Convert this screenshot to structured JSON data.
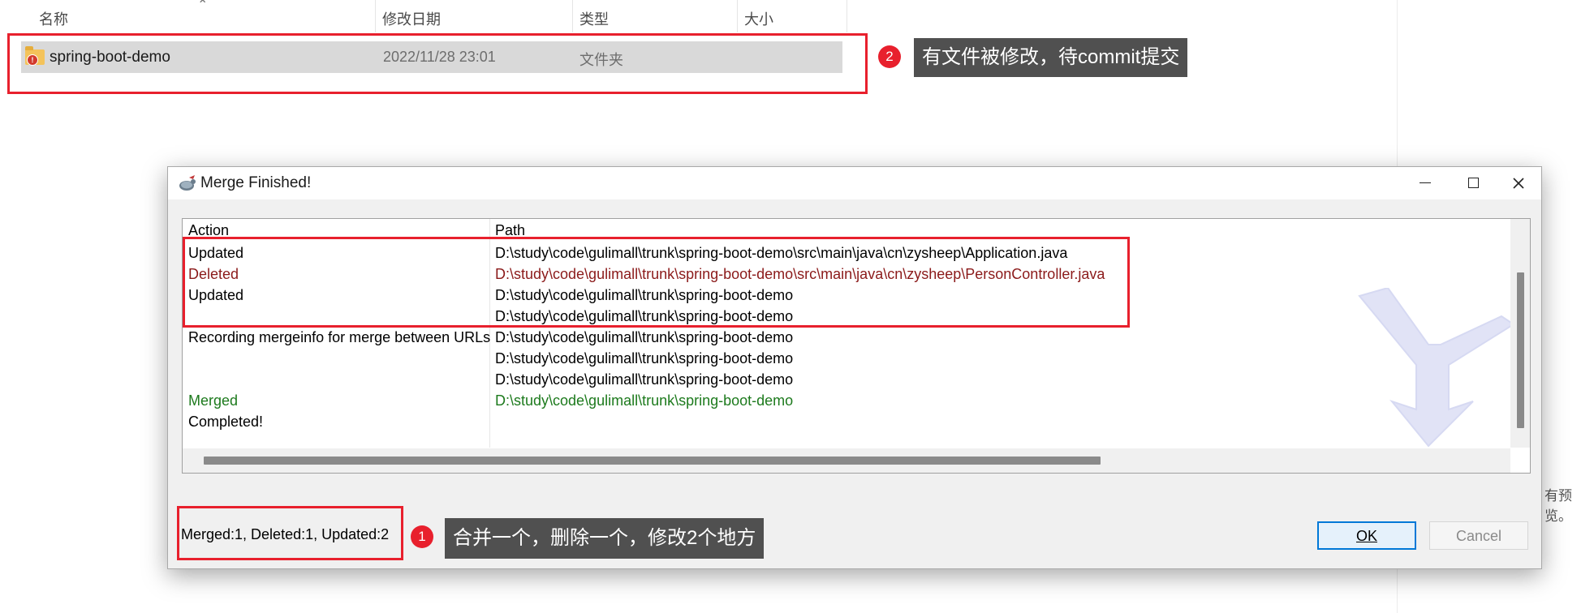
{
  "explorer": {
    "columns": [
      "名称",
      "修改日期",
      "类型",
      "大小"
    ],
    "file": {
      "name": "spring-boot-demo",
      "date": "2022/11/28 23:01",
      "type": "文件夹"
    },
    "preview_text": "有预览。"
  },
  "annotations": [
    {
      "number": "2",
      "text": "有文件被修改，待commit提交"
    },
    {
      "number": "1",
      "text": "合并一个，删除一个，修改2个地方"
    }
  ],
  "dialog": {
    "title": "Merge Finished!",
    "headers": {
      "action": "Action",
      "path": "Path"
    },
    "rows": [
      {
        "action": "Updated",
        "path": "D:\\study\\code\\gulimall\\trunk\\spring-boot-demo\\src\\main\\java\\cn\\zysheep\\Application.java",
        "kind": "normal"
      },
      {
        "action": "Deleted",
        "path": "D:\\study\\code\\gulimall\\trunk\\spring-boot-demo\\src\\main\\java\\cn\\zysheep\\PersonController.java",
        "kind": "deleted"
      },
      {
        "action": "Updated",
        "path": "D:\\study\\code\\gulimall\\trunk\\spring-boot-demo",
        "kind": "normal"
      },
      {
        "action": "",
        "path": "D:\\study\\code\\gulimall\\trunk\\spring-boot-demo",
        "kind": "normal"
      },
      {
        "action": "Recording mergeinfo for merge between URLs",
        "path": "D:\\study\\code\\gulimall\\trunk\\spring-boot-demo",
        "kind": "normal"
      },
      {
        "action": "",
        "path": "D:\\study\\code\\gulimall\\trunk\\spring-boot-demo",
        "kind": "normal"
      },
      {
        "action": "",
        "path": "D:\\study\\code\\gulimall\\trunk\\spring-boot-demo",
        "kind": "normal"
      },
      {
        "action": "Merged",
        "path": "D:\\study\\code\\gulimall\\trunk\\spring-boot-demo",
        "kind": "merged"
      },
      {
        "action": "Completed!",
        "path": "",
        "kind": "normal"
      }
    ],
    "status": "Merged:1, Deleted:1, Updated:2",
    "buttons": {
      "ok": "OK",
      "cancel": "Cancel"
    }
  },
  "colors": {
    "highlight": "#e8202d",
    "callout_bg": "#505050",
    "deleted_text": "#8b1a1a",
    "merged_text": "#1d7a1d",
    "accent": "#0078d7"
  },
  "icons": [
    "svn-conflict-folder-icon",
    "tortoisesvn-app-icon",
    "minimize-icon",
    "maximize-icon",
    "close-icon",
    "merge-watermark-icon"
  ]
}
